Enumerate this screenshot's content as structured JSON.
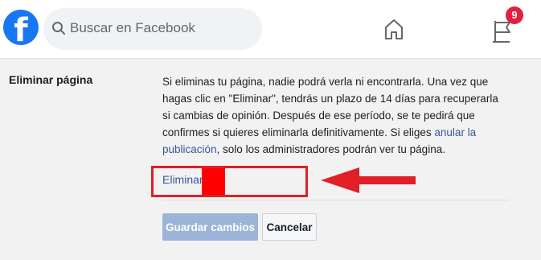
{
  "topbar": {
    "logo_letter": "f",
    "search_placeholder": "Buscar en Facebook",
    "notification_count": "9",
    "brand_color": "#1877f2",
    "badge_color": "#e41e3f",
    "icons": [
      "search-icon",
      "home-icon",
      "flag-icon"
    ]
  },
  "settings_row": {
    "label": "Eliminar página",
    "description_part1": "Si eliminas tu página, nadie podrá verla ni encontrarla. Una vez que hagas clic en \"Eliminar\", tendrás un plazo de 14 días para recuperarla si cambias de opinión. Después de ese período, se te pedirá que confirmes si quieres eliminarla definitivamente. Si eliges ",
    "unpublish_link": "anular la publicación",
    "description_part2": ", solo los administradores podrán ver tu página.",
    "delete_link": "Eliminar",
    "link_color": "#385898"
  },
  "actions": {
    "save_label": "Guardar cambios",
    "cancel_label": "Cancelar"
  },
  "annotation": {
    "color": "#e11f26"
  }
}
